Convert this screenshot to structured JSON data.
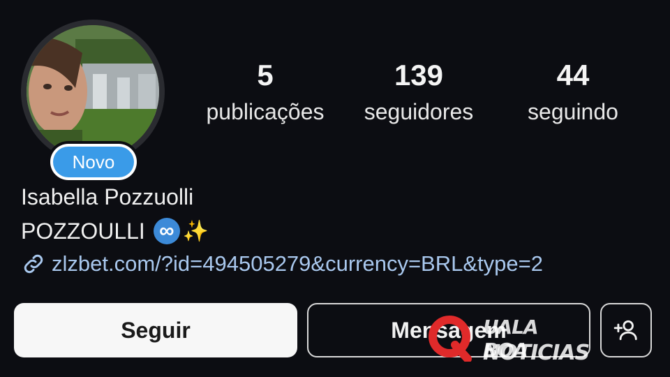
{
  "profile": {
    "avatar_alt": "profile photo",
    "new_badge": "Novo",
    "name": "Isabella Pozzuolli",
    "bio_text": "POZZOULLI",
    "bio_emoji_1": "∞",
    "bio_emoji_2": "✨",
    "link": "zlzbet.com/?id=494505279&currency=BRL&type=2"
  },
  "stats": {
    "posts": {
      "value": "5",
      "label": "publicações"
    },
    "followers": {
      "value": "139",
      "label": "seguidores"
    },
    "following": {
      "value": "44",
      "label": "seguindo"
    }
  },
  "actions": {
    "follow_label": "Seguir",
    "message_label": "Mensagem",
    "suggest_icon": "add-person-icon"
  },
  "watermark": {
    "line1": "UALA BOA",
    "line2": "NOTICIAS"
  },
  "colors": {
    "background": "#0c0d12",
    "link": "#a9c8ee",
    "badge": "#3a9be8",
    "watermark_red": "#e02a2a"
  }
}
